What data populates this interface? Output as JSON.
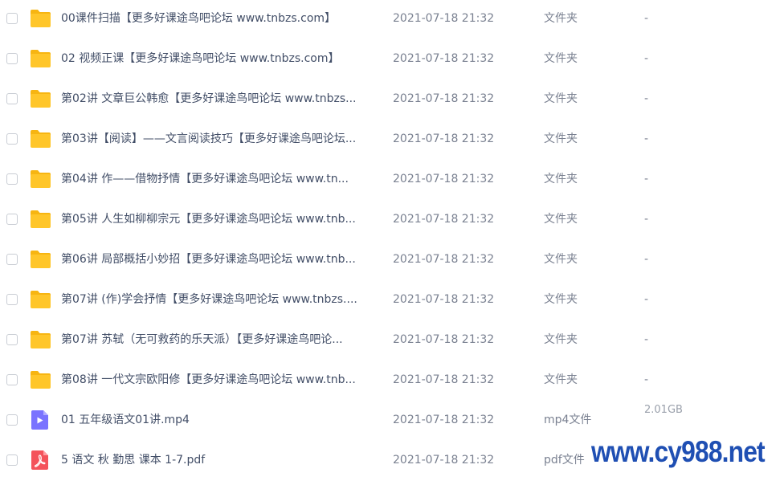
{
  "files": [
    {
      "name": "00课件扫描【更多好课途鸟吧论坛 www.tnbzs.com】",
      "date": "2021-07-18 21:32",
      "type": "文件夹",
      "size": "-",
      "icon": "folder-icon"
    },
    {
      "name": "02 视频正课【更多好课途鸟吧论坛 www.tnbzs.com】",
      "date": "2021-07-18 21:32",
      "type": "文件夹",
      "size": "-",
      "icon": "folder-icon"
    },
    {
      "name": "第02讲 文章巨公韩愈【更多好课途鸟吧论坛 www.tnbzs...",
      "date": "2021-07-18 21:32",
      "type": "文件夹",
      "size": "-",
      "icon": "folder-icon"
    },
    {
      "name": "第03讲【阅读】——文言阅读技巧【更多好课途鸟吧论坛...",
      "date": "2021-07-18 21:32",
      "type": "文件夹",
      "size": "-",
      "icon": "folder-icon"
    },
    {
      "name": "第04讲 作——借物抒情【更多好课途鸟吧论坛 www.tn...",
      "date": "2021-07-18 21:32",
      "type": "文件夹",
      "size": "-",
      "icon": "folder-icon"
    },
    {
      "name": "第05讲 人生如柳柳宗元【更多好课途鸟吧论坛 www.tnb...",
      "date": "2021-07-18 21:32",
      "type": "文件夹",
      "size": "-",
      "icon": "folder-icon"
    },
    {
      "name": "第06讲 局部概括小妙招【更多好课途鸟吧论坛 www.tnb...",
      "date": "2021-07-18 21:32",
      "type": "文件夹",
      "size": "-",
      "icon": "folder-icon"
    },
    {
      "name": "第07讲 (作)学会抒情【更多好课途鸟吧论坛 www.tnbzs....",
      "date": "2021-07-18 21:32",
      "type": "文件夹",
      "size": "-",
      "icon": "folder-icon"
    },
    {
      "name": "第07讲 苏轼（无可救药的乐天派）【更多好课途鸟吧论...",
      "date": "2021-07-18 21:32",
      "type": "文件夹",
      "size": "-",
      "icon": "folder-icon"
    },
    {
      "name": "第08讲 一代文宗欧阳修【更多好课途鸟吧论坛 www.tnb...",
      "date": "2021-07-18 21:32",
      "type": "文件夹",
      "size": "-",
      "icon": "folder-icon"
    },
    {
      "name": "01 五年级语文01讲.mp4",
      "date": "2021-07-18 21:32",
      "type": "mp4文件",
      "size": "2.01GB",
      "icon": "video-file-icon"
    },
    {
      "name": "5 语文 秋 勤思  课本 1-7.pdf",
      "date": "2021-07-18 21:32",
      "type": "pdf文件",
      "size": "",
      "icon": "pdf-file-icon"
    }
  ],
  "watermark": "www.cy988.net",
  "colors": {
    "folder": "#ffc62a",
    "folder_tab": "#f7b512",
    "video": "#7a73ff",
    "pdf": "#f4535b",
    "text": "#424e67",
    "muted": "#7a8191",
    "watermark": "#1f4fb3"
  }
}
